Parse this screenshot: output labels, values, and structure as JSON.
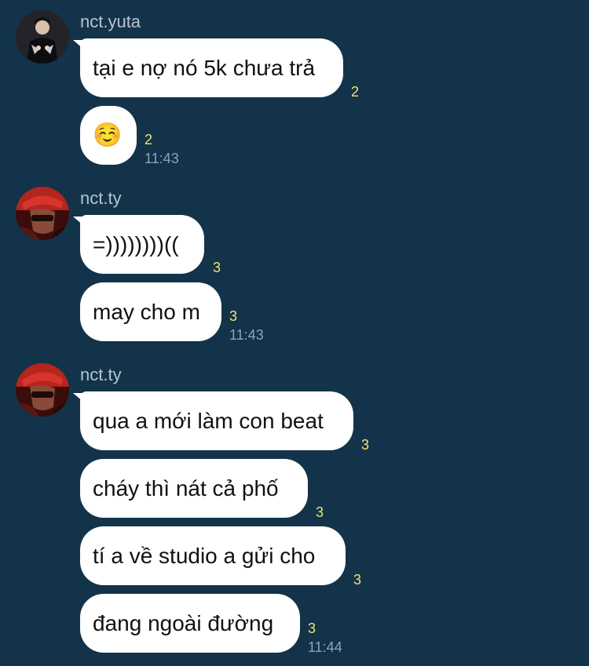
{
  "colors": {
    "background": "#12334a",
    "bubble": "#ffffff",
    "read_count": "#f3e46a",
    "sender": "#b9c4ce",
    "timestamp": "#93a3b1"
  },
  "groups": [
    {
      "sender": "nct.yuta",
      "avatar": "avatar-yuta",
      "messages": [
        {
          "text": "tại e nợ nó 5k chưa trả",
          "read_count": "2"
        },
        {
          "text": "☺️",
          "read_count": "2",
          "time": "11:43"
        }
      ]
    },
    {
      "sender": "nct.ty",
      "avatar": "avatar-ty",
      "messages": [
        {
          "text": "=))))))))((",
          "read_count": "3"
        },
        {
          "text": "may cho m",
          "read_count": "3",
          "time": "11:43"
        }
      ]
    },
    {
      "sender": "nct.ty",
      "avatar": "avatar-ty",
      "messages": [
        {
          "text": "qua a mới làm con beat",
          "read_count": "3"
        },
        {
          "text": "cháy thì nát cả phố",
          "read_count": "3"
        },
        {
          "text": "tí a về studio a gửi cho",
          "read_count": "3"
        },
        {
          "text": "đang ngoài đường",
          "read_count": "3",
          "time": "11:44"
        }
      ]
    }
  ]
}
